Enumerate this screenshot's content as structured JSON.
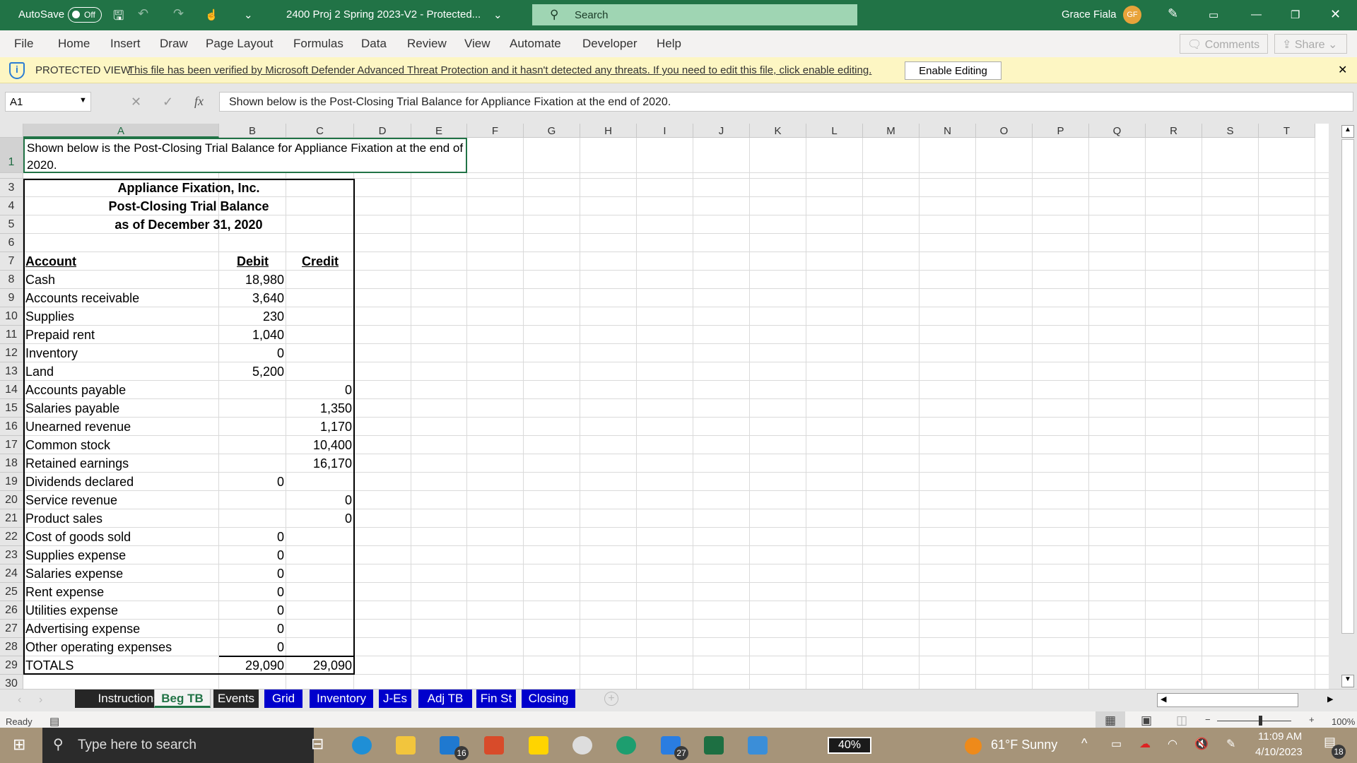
{
  "titlebar": {
    "autosave": "AutoSave",
    "autosave_state": "Off",
    "doc_title": "2400 Proj 2 Spring 2023-V2  -  Protected...",
    "search_placeholder": "Search",
    "user_name": "Grace Fiala",
    "user_initials": "GF",
    "accent": "#217346"
  },
  "menu": [
    "File",
    "Home",
    "Insert",
    "Draw",
    "Page Layout",
    "Formulas",
    "Data",
    "Review",
    "View",
    "Automate",
    "Developer",
    "Help"
  ],
  "ribbon_buttons": {
    "comments": "Comments",
    "share": "Share"
  },
  "protected_view": {
    "label": "PROTECTED VIEW",
    "message": "This file has been verified by Microsoft Defender Advanced Threat Protection and it hasn't detected any threats. If you need to edit this file, click enable editing.",
    "button": "Enable Editing"
  },
  "formula_bar": {
    "name_box": "A1",
    "fx": "fx",
    "formula": "Shown below is the Post-Closing Trial Balance for Appliance Fixation at the end of 2020."
  },
  "columns": [
    "A",
    "B",
    "C",
    "D",
    "E",
    "F",
    "G",
    "H",
    "I",
    "J",
    "K",
    "L",
    "M",
    "N",
    "O",
    "P",
    "Q",
    "R",
    "S",
    "T"
  ],
  "sheet": {
    "a1_line1": "Shown below is the Post-Closing Trial Balance for Appliance Fixation at the end of",
    "a1_line2": "2020.",
    "company": "Appliance Fixation, Inc.",
    "report": "Post-Closing Trial Balance",
    "date": "as of December 31, 2020",
    "headers": {
      "account": "Account",
      "debit": "Debit",
      "credit": "Credit"
    },
    "rows": [
      {
        "account": "Cash",
        "debit": "18,980",
        "credit": ""
      },
      {
        "account": "Accounts receivable",
        "debit": "3,640",
        "credit": ""
      },
      {
        "account": "Supplies",
        "debit": "230",
        "credit": ""
      },
      {
        "account": "Prepaid rent",
        "debit": "1,040",
        "credit": ""
      },
      {
        "account": "Inventory",
        "debit": "0",
        "credit": ""
      },
      {
        "account": "Land",
        "debit": "5,200",
        "credit": ""
      },
      {
        "account": "Accounts payable",
        "debit": "",
        "credit": "0"
      },
      {
        "account": "Salaries payable",
        "debit": "",
        "credit": "1,350"
      },
      {
        "account": "Unearned revenue",
        "debit": "",
        "credit": "1,170"
      },
      {
        "account": "Common stock",
        "debit": "",
        "credit": "10,400"
      },
      {
        "account": "Retained earnings",
        "debit": "",
        "credit": "16,170"
      },
      {
        "account": "Dividends declared",
        "debit": "0",
        "credit": ""
      },
      {
        "account": "Service revenue",
        "debit": "",
        "credit": "0"
      },
      {
        "account": "Product sales",
        "debit": "",
        "credit": "0"
      },
      {
        "account": "Cost of goods sold",
        "debit": "0",
        "credit": ""
      },
      {
        "account": "Supplies expense",
        "debit": "0",
        "credit": ""
      },
      {
        "account": "Salaries expense",
        "debit": "0",
        "credit": ""
      },
      {
        "account": "Rent expense",
        "debit": "0",
        "credit": ""
      },
      {
        "account": "Utilities expense",
        "debit": "0",
        "credit": ""
      },
      {
        "account": "Advertising expense",
        "debit": "0",
        "credit": ""
      },
      {
        "account": "Other operating expenses",
        "debit": "0",
        "credit": ""
      }
    ],
    "totals": {
      "label": "TOTALS",
      "debit": "29,090",
      "credit": "29,090"
    }
  },
  "tabs": [
    {
      "label": "Instructions",
      "color": "#262626",
      "text": "#ffffff"
    },
    {
      "label": "Beg TB",
      "color": "#f3f3f3",
      "text": "#217346",
      "active": true
    },
    {
      "label": "Events",
      "color": "#262626",
      "text": "#ffffff"
    },
    {
      "label": "Grid",
      "color": "#0000cc",
      "text": "#ffffff"
    },
    {
      "label": "Inventory",
      "color": "#0000cc",
      "text": "#ffffff"
    },
    {
      "label": "J-Es",
      "color": "#0000cc",
      "text": "#ffffff"
    },
    {
      "label": "Adj TB",
      "color": "#0000cc",
      "text": "#ffffff"
    },
    {
      "label": "Fin St",
      "color": "#0000cc",
      "text": "#ffffff"
    },
    {
      "label": "Closing",
      "color": "#0000cc",
      "text": "#ffffff"
    }
  ],
  "status": {
    "ready": "Ready",
    "zoom": "100%"
  },
  "taskbar": {
    "search_placeholder": "Type here to search",
    "mail_badge": "16",
    "todo_badge": "27",
    "battery": "40%",
    "weather": "61°F  Sunny",
    "time": "11:09 AM",
    "date": "4/10/2023",
    "notifications": "18"
  }
}
